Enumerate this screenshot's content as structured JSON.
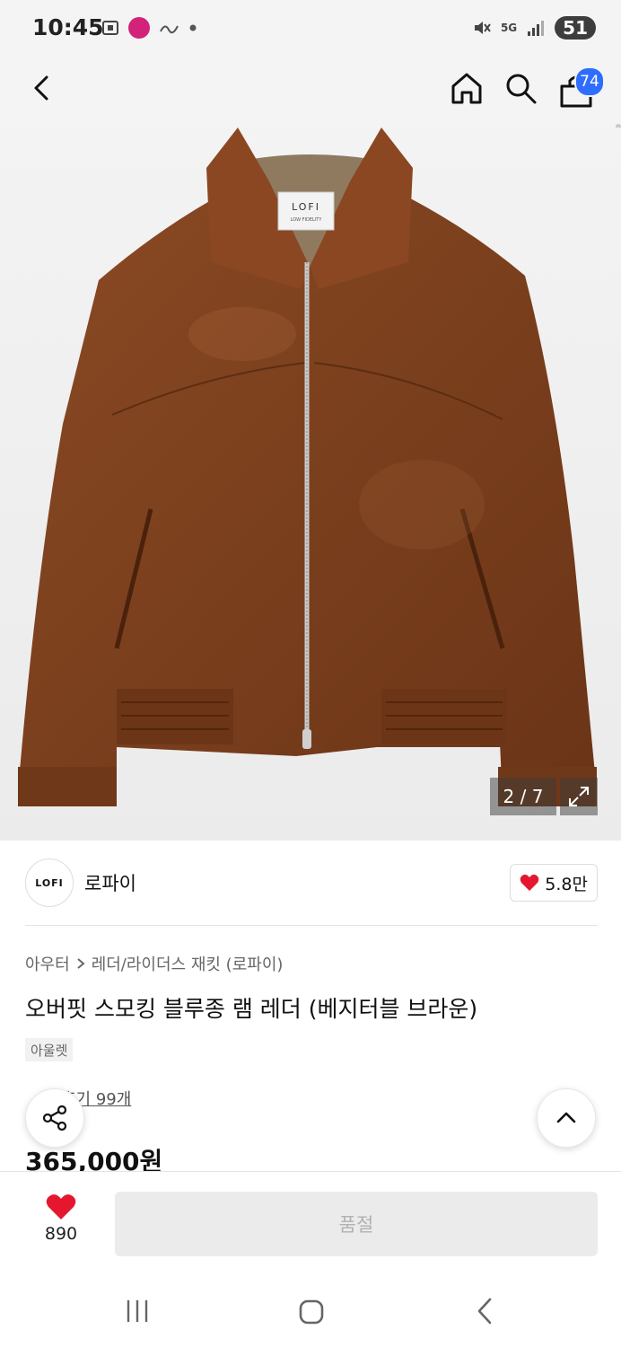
{
  "status_bar": {
    "time": "10:45",
    "network": "5G",
    "battery": "51"
  },
  "header": {
    "cart_count": "74"
  },
  "gallery": {
    "counter": "2 / 7",
    "brand_label": "LOFI",
    "brand_sub": "LOW FIDELITY"
  },
  "brand": {
    "logo_text": "LOFI",
    "name": "로파이",
    "likes": "5.8만"
  },
  "product": {
    "breadcrumb": [
      "아우터",
      "레더/라이더스 재킷 (로파이)"
    ],
    "title": "오버핏 스모킹 블루종 램 레더 (베지터블 브라운)",
    "tag": "아울렛",
    "review_link": "후기 99개",
    "price": "365,000원"
  },
  "bottom": {
    "wish_count": "890",
    "buy_button": "품절"
  },
  "colors": {
    "accent_blue": "#2f6dff",
    "heart_red": "#e5172f",
    "jacket_brown": "#7a3f1d"
  }
}
